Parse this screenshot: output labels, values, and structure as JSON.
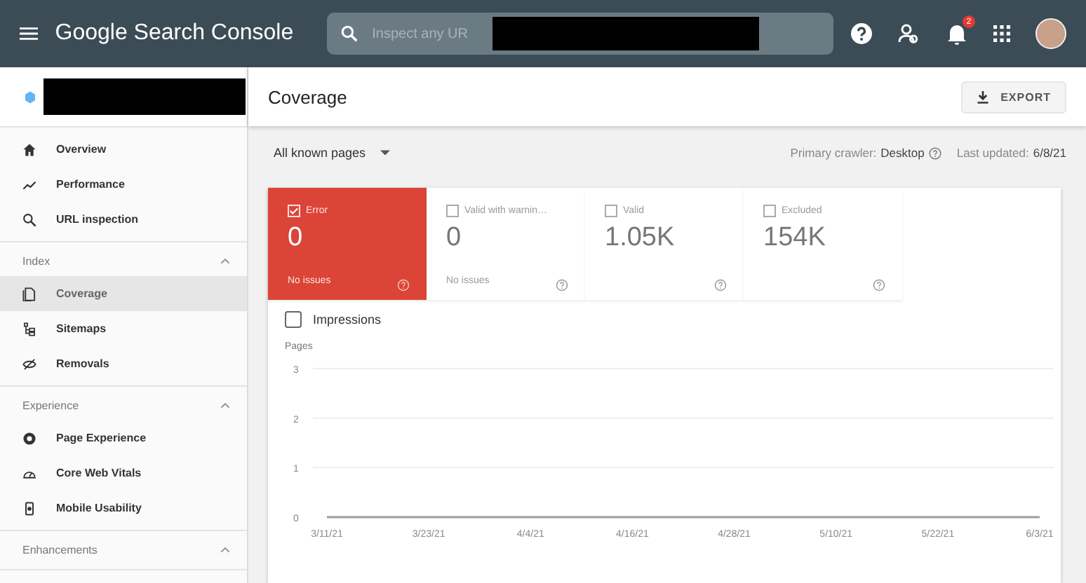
{
  "app_bar": {
    "title": "Google Search Console",
    "search": {
      "placeholder": "Inspect any UR"
    },
    "notification_badge": "2"
  },
  "sidebar": {
    "sections": [
      {
        "items": [
          {
            "label": "Overview",
            "selected": false
          },
          {
            "label": "Performance",
            "selected": false
          },
          {
            "label": "URL inspection",
            "selected": false
          }
        ]
      },
      {
        "heading": "Index",
        "expanded": true,
        "items": [
          {
            "label": "Coverage",
            "selected": true
          },
          {
            "label": "Sitemaps",
            "selected": false
          },
          {
            "label": "Removals",
            "selected": false
          }
        ]
      },
      {
        "heading": "Experience",
        "expanded": true,
        "items": [
          {
            "label": "Page Experience",
            "selected": false
          },
          {
            "label": "Core Web Vitals",
            "selected": false
          },
          {
            "label": "Mobile Usability",
            "selected": false
          }
        ]
      },
      {
        "heading": "Enhancements",
        "expanded": true
      }
    ]
  },
  "page": {
    "title": "Coverage",
    "export_button": "EXPORT",
    "filter": "All known pages",
    "crawler_label": "Primary crawler:",
    "crawler_value": "Desktop",
    "updated_label": "Last updated:",
    "updated_value": "6/8/21"
  },
  "cards": [
    {
      "label": "Error",
      "value": "0",
      "note": "No issues",
      "selected": true
    },
    {
      "label": "Valid with warnin…",
      "value": "0",
      "note": "No issues",
      "selected": false
    },
    {
      "label": "Valid",
      "value": "1.05K",
      "selected": false
    },
    {
      "label": "Excluded",
      "value": "154K",
      "selected": false
    }
  ],
  "impressions": {
    "label": "Impressions",
    "checked": false
  },
  "chart_data": {
    "type": "line",
    "ylabel": "Pages",
    "categories": [
      "3/11/21",
      "3/23/21",
      "4/4/21",
      "4/16/21",
      "4/28/21",
      "5/10/21",
      "5/22/21",
      "6/3/21"
    ],
    "yticks": [
      0,
      1,
      2,
      3
    ],
    "ylim": [
      0,
      3
    ],
    "series": [
      {
        "color": "#9e9e9e",
        "values": [
          0,
          0,
          0,
          0,
          0,
          0,
          0,
          0
        ]
      }
    ]
  }
}
